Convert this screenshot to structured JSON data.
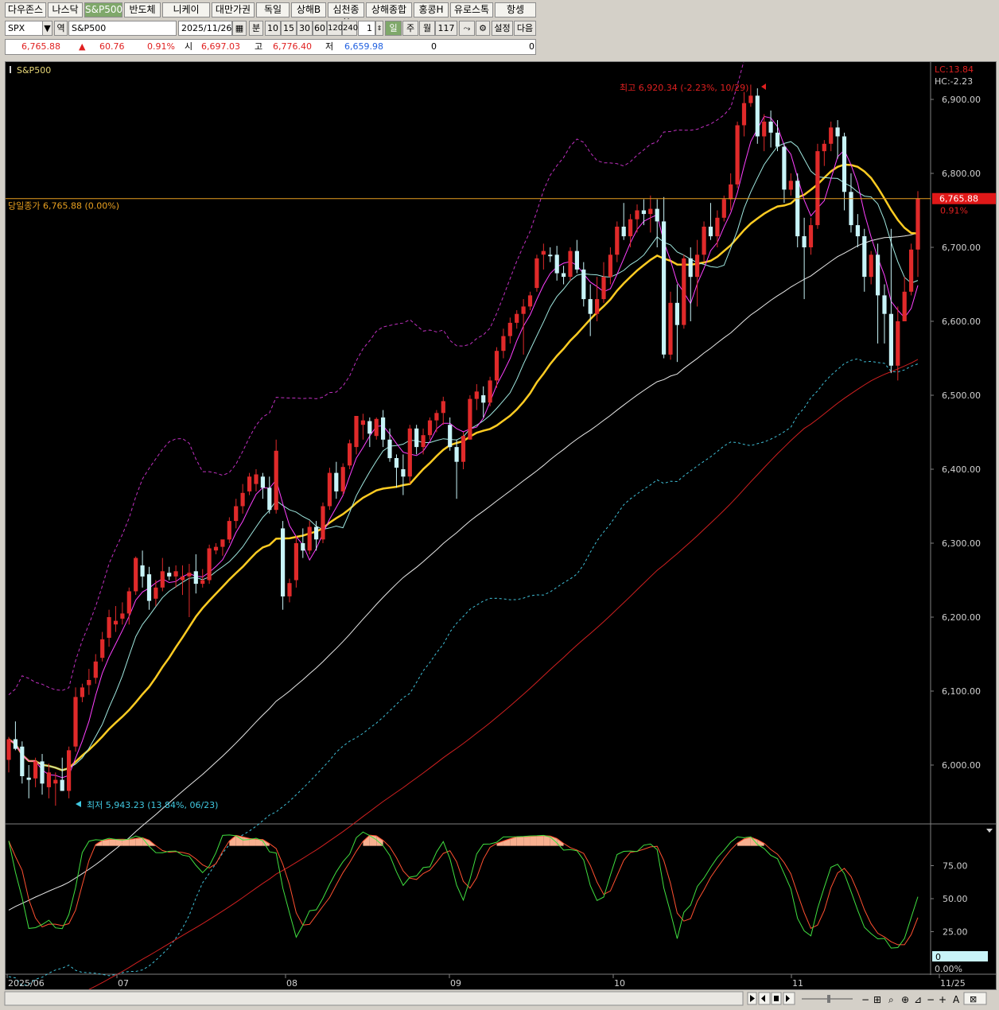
{
  "tabs": [
    "다우존스",
    "나스닥",
    "S&P500",
    "반도체",
    "니케이",
    "대만가권",
    "독일",
    "상해B",
    "심천종합",
    "상해종합",
    "홍콩H",
    "유로스톡",
    "항셍"
  ],
  "active_tab": "S&P500",
  "toolbar": {
    "code": "SPX",
    "search_label": "역",
    "name": "S&P500",
    "date": "2025/11/26",
    "unit": "분",
    "periods": [
      "10",
      "15",
      "30",
      "60",
      "120",
      "240"
    ],
    "count_value": "1",
    "day": "일",
    "week": "주",
    "month": "월",
    "bars": "117",
    "settings": "설정",
    "next": "다음"
  },
  "quote": {
    "price": "6,765.88",
    "arrow": "▲",
    "change": "60.76",
    "pct": "0.91%",
    "open_label": "시",
    "open": "6,697.03",
    "high_label": "고",
    "high": "6,776.40",
    "low_label": "저",
    "low": "6,659.98",
    "vol1": "0",
    "vol2": "0"
  },
  "chart": {
    "title": "S&P500",
    "close_label": "당일종가 6,765.88 (0.00%)",
    "high_annotation": "최고 6,920.34 (-2.23%, 10/29)",
    "low_annotation": "최저 5,943.23 (13.84%, 06/23)",
    "lc_label": "LC:13.84",
    "hc_label": "HC:-2.23",
    "price_tag": "6,765.88",
    "pct_tag": "0.91%",
    "stoch_last": "0",
    "stoch_pct": "0.00%",
    "x_labels": [
      "2025/06",
      "07",
      "08",
      "09",
      "10",
      "11",
      "11/25"
    ]
  },
  "chart_data": {
    "type": "candlestick",
    "y_ticks": [
      6000,
      6100,
      6200,
      6300,
      6400,
      6500,
      6600,
      6700,
      6800,
      6900
    ],
    "stoch_ticks": [
      25,
      50,
      75
    ],
    "last_close": 6765.88,
    "candles": [
      [
        6007,
        6038,
        5990,
        6035
      ],
      [
        6035,
        6059,
        6020,
        6022
      ],
      [
        6025,
        6032,
        5975,
        5985
      ],
      [
        5983,
        6000,
        5955,
        5980
      ],
      [
        5982,
        6010,
        5970,
        6005
      ],
      [
        6005,
        6015,
        5960,
        5975
      ],
      [
        5970,
        6002,
        5955,
        5990
      ],
      [
        5975,
        5990,
        5945,
        5980
      ],
      [
        5980,
        6010,
        5965,
        5965
      ],
      [
        5965,
        6025,
        5955,
        6020
      ],
      [
        6025,
        6105,
        6018,
        6092
      ],
      [
        6092,
        6110,
        6085,
        6105
      ],
      [
        6108,
        6130,
        6095,
        6115
      ],
      [
        6118,
        6150,
        6110,
        6140
      ],
      [
        6145,
        6180,
        6140,
        6170
      ],
      [
        6172,
        6210,
        6160,
        6200
      ],
      [
        6190,
        6215,
        6180,
        6195
      ],
      [
        6198,
        6220,
        6190,
        6205
      ],
      [
        6205,
        6240,
        6190,
        6235
      ],
      [
        6235,
        6282,
        6230,
        6280
      ],
      [
        6270,
        6290,
        6240,
        6255
      ],
      [
        6258,
        6268,
        6210,
        6222
      ],
      [
        6225,
        6250,
        6215,
        6240
      ],
      [
        6240,
        6280,
        6235,
        6262
      ],
      [
        6260,
        6268,
        6250,
        6255
      ],
      [
        6255,
        6270,
        6240,
        6262
      ],
      [
        6250,
        6270,
        6230,
        6255
      ],
      [
        6255,
        6272,
        6200,
        6260
      ],
      [
        6262,
        6285,
        6232,
        6245
      ],
      [
        6245,
        6265,
        6240,
        6250
      ],
      [
        6250,
        6298,
        6245,
        6293
      ],
      [
        6290,
        6300,
        6285,
        6295
      ],
      [
        6295,
        6302,
        6283,
        6305
      ],
      [
        6305,
        6335,
        6300,
        6330
      ],
      [
        6330,
        6360,
        6320,
        6350
      ],
      [
        6350,
        6380,
        6340,
        6368
      ],
      [
        6370,
        6395,
        6365,
        6390
      ],
      [
        6380,
        6400,
        6370,
        6393
      ],
      [
        6390,
        6395,
        6360,
        6375
      ],
      [
        6375,
        6390,
        6340,
        6345
      ],
      [
        6345,
        6440,
        6340,
        6425
      ],
      [
        6320,
        6330,
        6210,
        6228
      ],
      [
        6228,
        6252,
        6220,
        6246
      ],
      [
        6250,
        6310,
        6240,
        6300
      ],
      [
        6300,
        6320,
        6280,
        6290
      ],
      [
        6290,
        6330,
        6285,
        6322
      ],
      [
        6322,
        6330,
        6290,
        6305
      ],
      [
        6305,
        6355,
        6300,
        6350
      ],
      [
        6350,
        6402,
        6345,
        6395
      ],
      [
        6395,
        6410,
        6360,
        6370
      ],
      [
        6370,
        6408,
        6365,
        6403
      ],
      [
        6405,
        6440,
        6400,
        6435
      ],
      [
        6430,
        6455,
        6420,
        6472
      ],
      [
        6460,
        6475,
        6440,
        6466
      ],
      [
        6465,
        6470,
        6430,
        6448
      ],
      [
        6445,
        6470,
        6440,
        6468
      ],
      [
        6470,
        6480,
        6430,
        6440
      ],
      [
        6440,
        6455,
        6410,
        6415
      ],
      [
        6415,
        6420,
        6375,
        6402
      ],
      [
        6400,
        6420,
        6365,
        6390
      ],
      [
        6390,
        6460,
        6380,
        6455
      ],
      [
        6455,
        6460,
        6420,
        6430
      ],
      [
        6430,
        6455,
        6420,
        6446
      ],
      [
        6446,
        6470,
        6440,
        6466
      ],
      [
        6466,
        6480,
        6450,
        6476
      ],
      [
        6476,
        6498,
        6460,
        6492
      ],
      [
        6460,
        6470,
        6425,
        6430
      ],
      [
        6430,
        6440,
        6360,
        6410
      ],
      [
        6410,
        6450,
        6400,
        6445
      ],
      [
        6440,
        6500,
        6440,
        6495
      ],
      [
        6495,
        6515,
        6480,
        6505
      ],
      [
        6500,
        6512,
        6470,
        6490
      ],
      [
        6490,
        6525,
        6485,
        6520
      ],
      [
        6520,
        6565,
        6510,
        6560
      ],
      [
        6560,
        6590,
        6550,
        6580
      ],
      [
        6580,
        6605,
        6570,
        6598
      ],
      [
        6598,
        6615,
        6590,
        6610
      ],
      [
        6610,
        6630,
        6555,
        6620
      ],
      [
        6620,
        6640,
        6615,
        6635
      ],
      [
        6645,
        6690,
        6640,
        6685
      ],
      [
        6690,
        6705,
        6670,
        6695
      ],
      [
        6690,
        6700,
        6680,
        6688
      ],
      [
        6690,
        6702,
        6655,
        6665
      ],
      [
        6665,
        6675,
        6650,
        6660
      ],
      [
        6660,
        6700,
        6655,
        6695
      ],
      [
        6695,
        6710,
        6665,
        6670
      ],
      [
        6670,
        6680,
        6620,
        6630
      ],
      [
        6630,
        6650,
        6580,
        6610
      ],
      [
        6610,
        6660,
        6600,
        6630
      ],
      [
        6630,
        6680,
        6625,
        6660
      ],
      [
        6660,
        6700,
        6650,
        6690
      ],
      [
        6690,
        6735,
        6680,
        6728
      ],
      [
        6728,
        6760,
        6710,
        6715
      ],
      [
        6715,
        6745,
        6700,
        6738
      ],
      [
        6738,
        6758,
        6720,
        6750
      ],
      [
        6750,
        6765,
        6730,
        6745
      ],
      [
        6745,
        6770,
        6720,
        6752
      ],
      [
        6752,
        6765,
        6700,
        6735
      ],
      [
        6735,
        6768,
        6550,
        6555
      ],
      [
        6555,
        6640,
        6548,
        6625
      ],
      [
        6625,
        6650,
        6545,
        6595
      ],
      [
        6595,
        6690,
        6590,
        6685
      ],
      [
        6685,
        6700,
        6600,
        6660
      ],
      [
        6660,
        6710,
        6620,
        6690
      ],
      [
        6690,
        6735,
        6680,
        6728
      ],
      [
        6728,
        6760,
        6710,
        6715
      ],
      [
        6715,
        6750,
        6700,
        6740
      ],
      [
        6740,
        6770,
        6735,
        6765
      ],
      [
        6765,
        6800,
        6750,
        6785
      ],
      [
        6785,
        6870,
        6780,
        6865
      ],
      [
        6865,
        6910,
        6850,
        6895
      ],
      [
        6895,
        6920,
        6890,
        6905
      ],
      [
        6905,
        6915,
        6840,
        6850
      ],
      [
        6850,
        6880,
        6830,
        6870
      ],
      [
        6870,
        6885,
        6835,
        6855
      ],
      [
        6855,
        6872,
        6830,
        6836
      ],
      [
        6836,
        6840,
        6760,
        6778
      ],
      [
        6778,
        6800,
        6770,
        6790
      ],
      [
        6790,
        6800,
        6700,
        6715
      ],
      [
        6715,
        6740,
        6630,
        6700
      ],
      [
        6700,
        6740,
        6690,
        6730
      ],
      [
        6730,
        6840,
        6725,
        6830
      ],
      [
        6830,
        6845,
        6810,
        6840
      ],
      [
        6840,
        6870,
        6830,
        6862
      ],
      [
        6862,
        6872,
        6820,
        6850
      ],
      [
        6850,
        6855,
        6750,
        6775
      ],
      [
        6775,
        6800,
        6720,
        6730
      ],
      [
        6730,
        6745,
        6700,
        6715
      ],
      [
        6715,
        6725,
        6640,
        6660
      ],
      [
        6660,
        6695,
        6650,
        6690
      ],
      [
        6690,
        6705,
        6570,
        6635
      ],
      [
        6635,
        6650,
        6570,
        6610
      ],
      [
        6610,
        6725,
        6530,
        6540
      ],
      [
        6540,
        6620,
        6520,
        6600
      ],
      [
        6600,
        6660,
        6610,
        6640
      ],
      [
        6640,
        6705,
        6635,
        6697
      ],
      [
        6697,
        6776,
        6660,
        6766
      ]
    ]
  },
  "colors": {
    "up": "#e02a2a",
    "down": "#c8f4f8",
    "ma5": "#ff40ff",
    "ma10": "#a0e8e0",
    "ma20": "#ffcc22",
    "ma60": "#e8e8e8",
    "ma120": "#d02020",
    "bb": "#c030c0",
    "env": "#40c0d8",
    "stoch_k": "#40e040",
    "stoch_d": "#ff5030",
    "accent_tab": "#7fa86a"
  }
}
